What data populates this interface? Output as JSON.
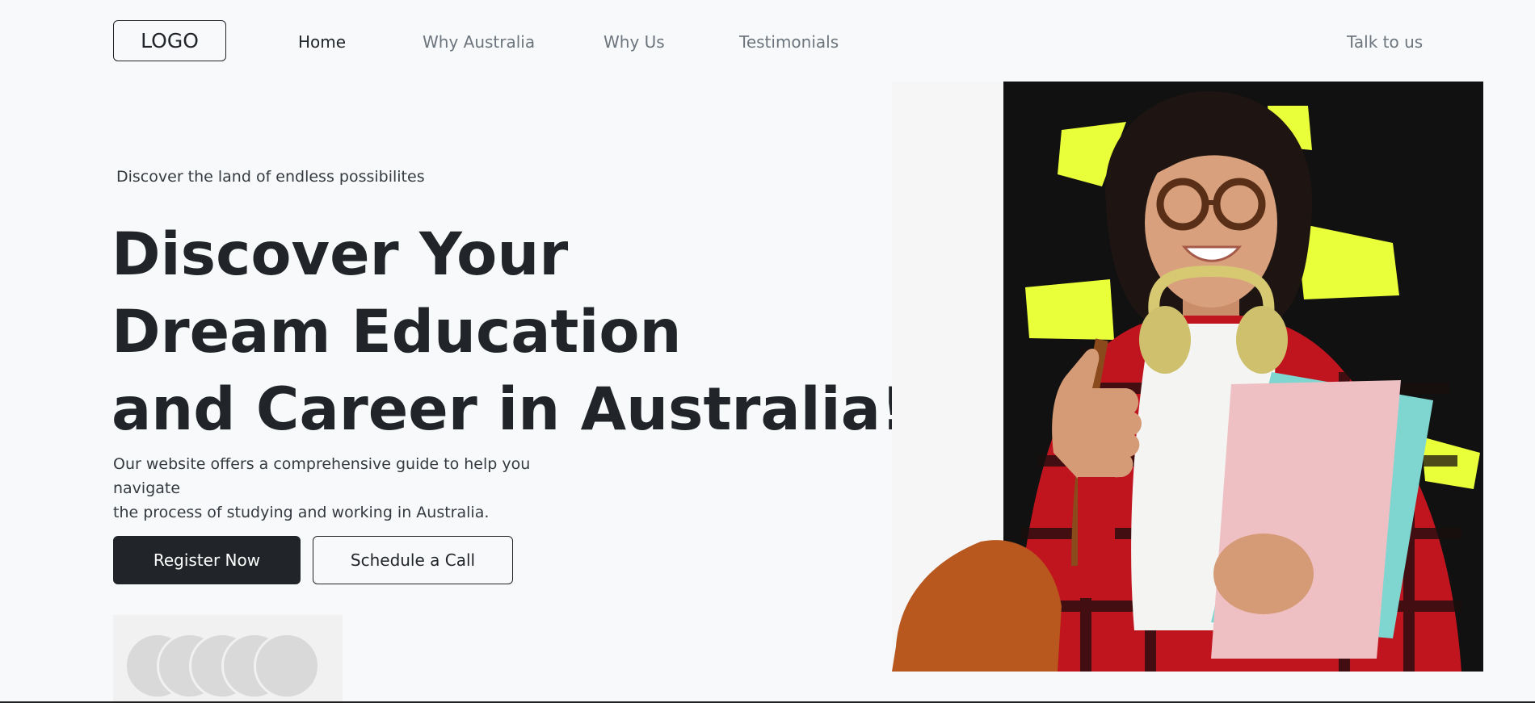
{
  "nav": {
    "logo": "LOGO",
    "links": [
      "Home",
      "Why Australia",
      "Why Us",
      "Testimonials"
    ],
    "cta": "Talk to us"
  },
  "hero": {
    "kicker": "Discover the land of endless possibilites",
    "headline": [
      "Discover Your",
      "Dream Education",
      "and Career in Australia!"
    ],
    "description": [
      "Our website offers a comprehensive guide to help you navigate",
      "the process of studying and working in Australia."
    ],
    "primary_button": "Register Now",
    "secondary_button": "Schedule a Call"
  },
  "colors": {
    "dark": "#212529",
    "muted": "#6c757d",
    "background": "#f8f9fa",
    "accent_yellow": "#e9ff3a",
    "photo_bg": "#111111"
  },
  "icons": {
    "avatar_stack": "avatar-placeholder-icon"
  }
}
